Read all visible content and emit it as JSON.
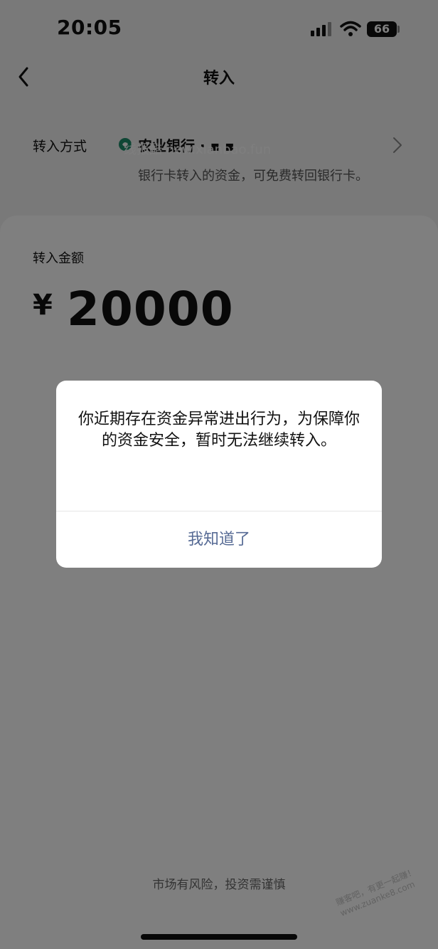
{
  "status_bar": {
    "time": "20:05",
    "battery": "66"
  },
  "nav": {
    "title": "转入"
  },
  "transfer_method": {
    "label": "转入方式",
    "bank_name": "农业银行 ·  ▪  ▪",
    "hint": "银行卡转入的资金，可免费转回银行卡。",
    "watermark": "线报酷 new.xianbao.fun"
  },
  "amount": {
    "label": "转入金额",
    "currency": "¥",
    "value": "20000"
  },
  "footer": {
    "risk_note": "市场有风险，投资需谨慎",
    "corner_watermark_line1": "赚客吧，有更一起赚！",
    "corner_watermark_line2": "www.zuanke8.com"
  },
  "dialog": {
    "message": "你近期存在资金异常进出行为，为保障你的资金安全，暂时无法继续转入。",
    "confirm_label": "我知道了"
  },
  "colors": {
    "overlay": "rgba(0,0,0,0.5)",
    "dialog_button": "#576b95",
    "card": "#ffffff",
    "page_bg": "#f3f3f3"
  }
}
